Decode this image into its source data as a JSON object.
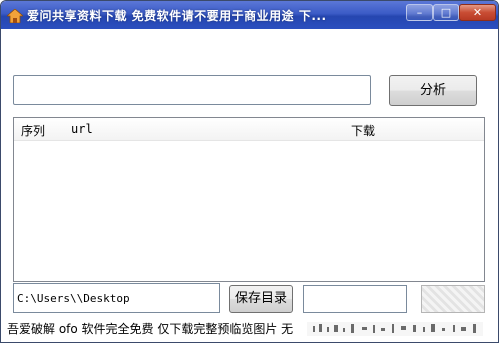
{
  "window": {
    "title": "爱问共享资料下载 免费软件请不要用于商业用途 下...",
    "min_glyph": "–",
    "max_glyph": "□",
    "close_glyph": "✕"
  },
  "url_input": {
    "value": ""
  },
  "buttons": {
    "analyze_label": "分析",
    "save_dir_label": "保存目录"
  },
  "list": {
    "columns": [
      "序列",
      "url",
      "下载"
    ],
    "rows": []
  },
  "path_input": {
    "value": "C:\\Users\\\\Desktop"
  },
  "captcha_input": {
    "value": ""
  },
  "status": {
    "text": "吾爱破解 ofo 软件完全免费 仅下载完整预临览图片 无"
  },
  "colors": {
    "titlebar": "#3b5bc6",
    "close_button": "#c94d34",
    "window_bg": "#ffffff"
  },
  "icons": {
    "app": "house-icon"
  }
}
